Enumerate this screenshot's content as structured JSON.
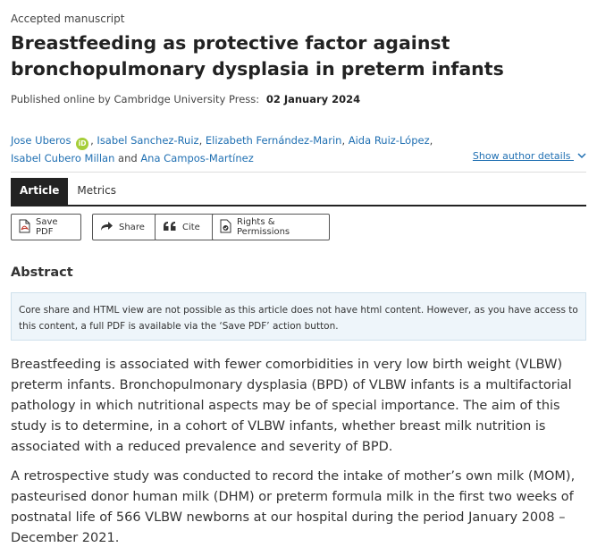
{
  "article": {
    "label": "Accepted manuscript",
    "title": "Breastfeeding as protective factor against bronchopulmonary dysplasia in preterm infants",
    "published_prefix": "Published online by Cambridge University Press:",
    "published_date": "02 January 2024"
  },
  "authors": {
    "list": [
      "Jose Uberos",
      "Isabel Sanchez-Ruiz",
      "Elizabeth Fernández-Marin",
      "Aida Ruiz-López",
      "Isabel Cubero Millan",
      "Ana Campos-Martínez"
    ],
    "separator": ",",
    "conjunction": "and",
    "orcid_label": "iD",
    "show_details": "Show author details"
  },
  "tabs": [
    {
      "label": "Article",
      "active": true
    },
    {
      "label": "Metrics",
      "active": false
    }
  ],
  "toolbar": {
    "save_pdf": "Save PDF",
    "share": "Share",
    "cite": "Cite",
    "rights": "Rights & Permissions"
  },
  "abstract": {
    "heading": "Abstract",
    "notice": "Core share and HTML view are not possible as this article does not have html content. However, as you have access to this content, a full PDF is available via the ‘Save PDF’ action button.",
    "paragraphs": [
      "Breastfeeding is associated with fewer comorbidities in very low birth weight (VLBW) preterm infants. Bronchopulmonary dysplasia (BPD) of VLBW infants is a multifactorial pathology in which nutritional aspects may be of special importance. The aim of this study is to determine, in a cohort of VLBW infants, whether breast milk nutrition is associated with a reduced prevalence and severity of BPD.",
      "A retrospective study was conducted to record the intake of mother’s own milk (MOM), pasteurised donor human milk (DHM) or preterm formula milk in the first two weeks of postnatal life of 566 VLBW newborns at our hospital during the period January 2008 – December 2021."
    ]
  },
  "colors": {
    "link": "#1f6fb2",
    "orcid": "#a6ce39",
    "notice_bg": "#eef5fa",
    "tab_active": "#222222"
  }
}
